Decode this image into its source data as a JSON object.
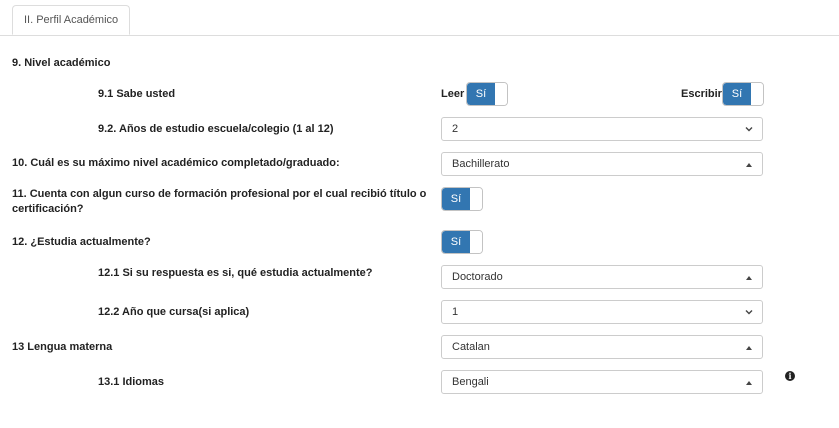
{
  "tab": {
    "label": "II. Perfil Académico"
  },
  "section": {
    "title": "9. Nivel académico"
  },
  "q9_1": {
    "label": "9.1 Sabe usted",
    "leer_label": "Leer",
    "leer_value": "Sí",
    "escribir_label": "Escribir",
    "escribir_value": "Sí"
  },
  "q9_2": {
    "label": "9.2. Años de estudio escuela/colegio (1 al 12)",
    "value": "2"
  },
  "q10": {
    "label": "10. Cuál es su máximo nivel académico completado/graduado:",
    "value": "Bachillerato"
  },
  "q11": {
    "label_line1": "11. Cuenta con algun curso de formación profesional por el cual recibió título o",
    "label_line2": "certificación?",
    "value": "Sí"
  },
  "q12": {
    "label": "12. ¿Estudia actualmente?",
    "value": "Sí"
  },
  "q12_1": {
    "label": "12.1 Si su respuesta es si, qué estudia actualmente?",
    "value": "Doctorado"
  },
  "q12_2": {
    "label": "12.2 Año que cursa(si aplica)",
    "value": "1"
  },
  "q13": {
    "label": "13 Lengua materna",
    "value": "Catalan"
  },
  "q13_1": {
    "label": "13.1 Idiomas",
    "value": "Bengali"
  },
  "colors": {
    "toggle_on": "#3276b1",
    "border": "#cccccc"
  },
  "icons": {
    "chevron": "chevron-down-icon",
    "caret": "caret-up-icon",
    "info": "info-circle-icon"
  }
}
